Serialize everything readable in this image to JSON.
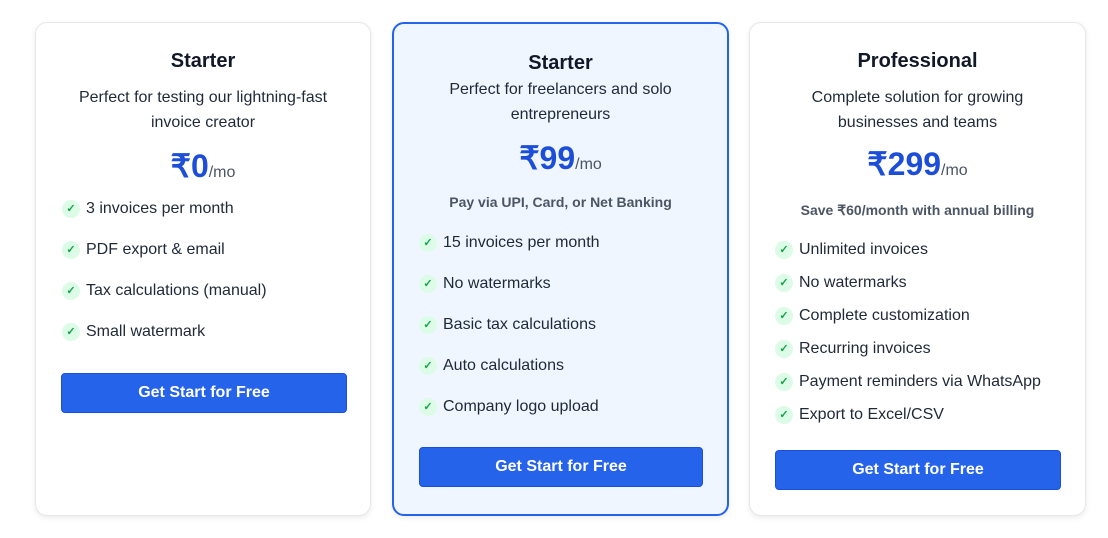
{
  "plans": [
    {
      "name": "Starter",
      "description": "Perfect for testing our lightning-fast invoice creator",
      "price": "₹0",
      "period": "/mo",
      "note": "",
      "features": [
        "3 invoices per month",
        "PDF export & email",
        "Tax calculations (manual)",
        "Small watermark"
      ],
      "button": "Get Start for Free"
    },
    {
      "name": "Starter",
      "description": "Perfect for freelancers and solo entrepreneurs",
      "price": "₹99",
      "period": "/mo",
      "note": "Pay via UPI, Card, or Net Banking",
      "features": [
        " 15 invoices per month",
        "No watermarks",
        "Basic tax calculations",
        "Auto calculations",
        "Company logo upload"
      ],
      "button": "Get Start for Free"
    },
    {
      "name": "Professional",
      "description": "Complete solution for growing businesses and teams",
      "price": "₹299",
      "period": "/mo",
      "note": "Save ₹60/month with annual billing",
      "features": [
        "Unlimited invoices",
        "No watermarks",
        "Complete customization",
        "Recurring invoices",
        "Payment reminders via WhatsApp",
        "Export to Excel/CSV"
      ],
      "button": "Get Start for Free"
    }
  ],
  "icons": {
    "feature": "check-icon"
  },
  "colors": {
    "accent": "#2563eb",
    "price": "#1d4ed8",
    "check": "#16a34a",
    "featured_bg": "#eff6ff"
  }
}
